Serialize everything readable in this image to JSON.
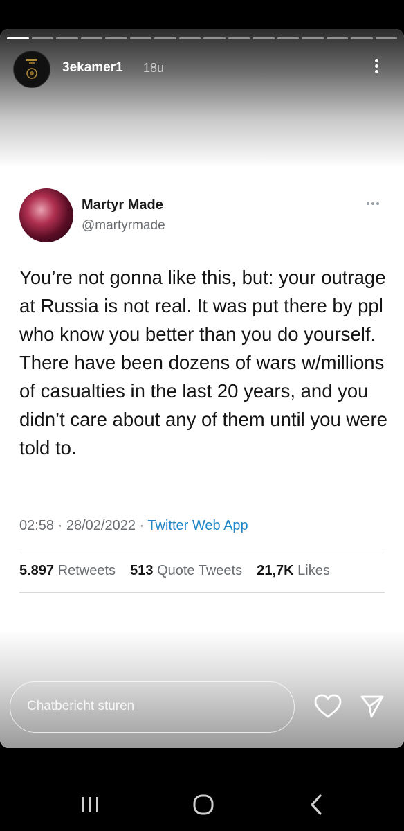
{
  "story": {
    "username": "3ekamer1",
    "time": "18u",
    "progress_segments": 16,
    "progress_done": 1
  },
  "tweet": {
    "name": "Martyr Made",
    "handle": "@martyrmade",
    "text": "You’re not gonna like this, but: your outrage at Russia is not real. It was put there by ppl who know you better than you do yourself. There have been dozens of wars w/millions of casualties in the last 20 years, and you didn’t care about any of them until you were told to.",
    "time": "02:58",
    "date": "28/02/2022",
    "separator": "·",
    "app": "Twitter Web App",
    "stats": {
      "retweets_count": "5.897",
      "retweets_label": "Retweets",
      "quotes_count": "513",
      "quotes_label": "Quote Tweets",
      "likes_count": "21,7K",
      "likes_label": "Likes"
    }
  },
  "reply": {
    "placeholder": "Chatbericht sturen"
  },
  "icons": {
    "heart": "heart-icon",
    "send": "send-icon",
    "more": "more-icon",
    "nav_recents": "recents-icon",
    "nav_home": "home-icon",
    "nav_back": "back-icon"
  },
  "colors": {
    "link": "#1d86c8",
    "muted": "#6a6e72",
    "text": "#141414"
  }
}
